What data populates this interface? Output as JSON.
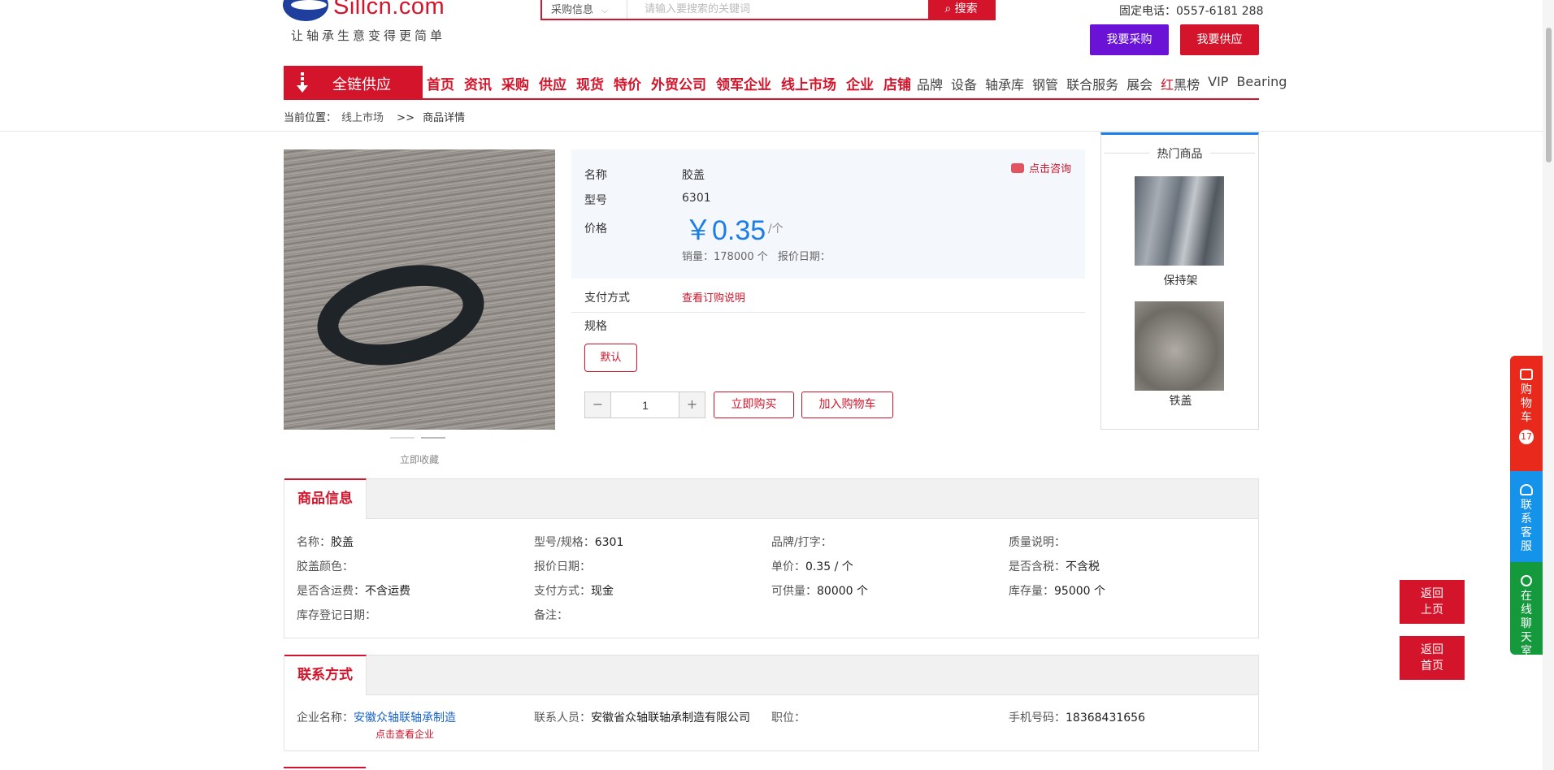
{
  "header": {
    "logo_text": "Sillcn.com",
    "slogan": "让轴承生意变得更简单",
    "search": {
      "category": "采购信息",
      "placeholder": "请输入要搜索的关键词",
      "button": "搜索"
    },
    "phone_label": "固定电话：",
    "phone_number": "0557-6181 288",
    "buy_button": "我要采购",
    "supply_button": "我要供应"
  },
  "nav": {
    "category_label": "全链供应",
    "main_items": [
      "首页",
      "资讯",
      "采购",
      "供应",
      "现货",
      "特价",
      "外贸公司",
      "领军企业",
      "线上市场",
      "企业",
      "店铺"
    ],
    "sub_items": [
      "品牌",
      "设备",
      "轴承库",
      "钢管",
      "联合服务",
      "展会"
    ],
    "redblack_red": "红",
    "redblack_black": "黑榜",
    "sub_items_tail": [
      "VIP",
      "Bearing"
    ]
  },
  "breadcrumb": {
    "label": "当前位置：",
    "parent": "线上市场",
    "separator": ">>",
    "current": "商品详情"
  },
  "gallery": {
    "collect_label": "立即收藏"
  },
  "product": {
    "name_label": "名称",
    "name": "胶盖",
    "model_label": "型号",
    "model": "6301",
    "price_label": "价格",
    "price": "￥0.35",
    "price_unit": "/个",
    "sales_text": "销量：178000 个",
    "quote_date_text": "报价日期：",
    "consult_label": "点击咨询",
    "payment_label": "支付方式",
    "payment_link": "查看订购说明",
    "spec_label": "规格",
    "spec_option": "默认",
    "quantity": "1",
    "buy_now": "立即购买",
    "add_cart": "加入购物车"
  },
  "hot": {
    "title": "热门商品",
    "items": [
      {
        "label": "保持架"
      },
      {
        "label": "铁盖"
      }
    ]
  },
  "goods_info": {
    "tab": "商品信息",
    "rows": [
      [
        {
          "k": "名称：",
          "v": "胶盖"
        },
        {
          "k": "型号/规格：",
          "v": "6301"
        },
        {
          "k": "品牌/打字：",
          "v": ""
        },
        {
          "k": "质量说明：",
          "v": ""
        }
      ],
      [
        {
          "k": "胶盖颜色：",
          "v": ""
        },
        {
          "k": "报价日期：",
          "v": ""
        },
        {
          "k": "单价：",
          "v": "0.35 / 个"
        },
        {
          "k": "是否含税：",
          "v": "不含税"
        }
      ],
      [
        {
          "k": "是否含运费：",
          "v": "不含运费"
        },
        {
          "k": "支付方式：",
          "v": "现金"
        },
        {
          "k": "可供量：",
          "v": "80000 个"
        },
        {
          "k": "库存量：",
          "v": "95000 个"
        }
      ],
      [
        {
          "k": "库存登记日期：",
          "v": ""
        },
        {
          "k": "备注：",
          "v": ""
        }
      ]
    ]
  },
  "contact": {
    "tab": "联系方式",
    "company_label": "企业名称：",
    "company_name": "安徽众轴联轴承制造",
    "company_sub": "点击查看企业",
    "person_label": "联系人员：",
    "person": "安徽省众轴联轴承制造有限公司",
    "position_label": "职位：",
    "position": "",
    "mobile_label": "手机号码：",
    "mobile": "18368431656"
  },
  "side": {
    "cart": "购物车",
    "cart_count": "17",
    "service": "联系客服",
    "chat": "在线聊天室"
  },
  "float_buttons": {
    "back_prev_1": "返回",
    "back_prev_2": "上页",
    "back_home_1": "返回",
    "back_home_2": "首页"
  },
  "colors": {
    "brand_red": "#d3142a",
    "purple": "#6a13d6",
    "price_blue": "#1a7ee6"
  }
}
